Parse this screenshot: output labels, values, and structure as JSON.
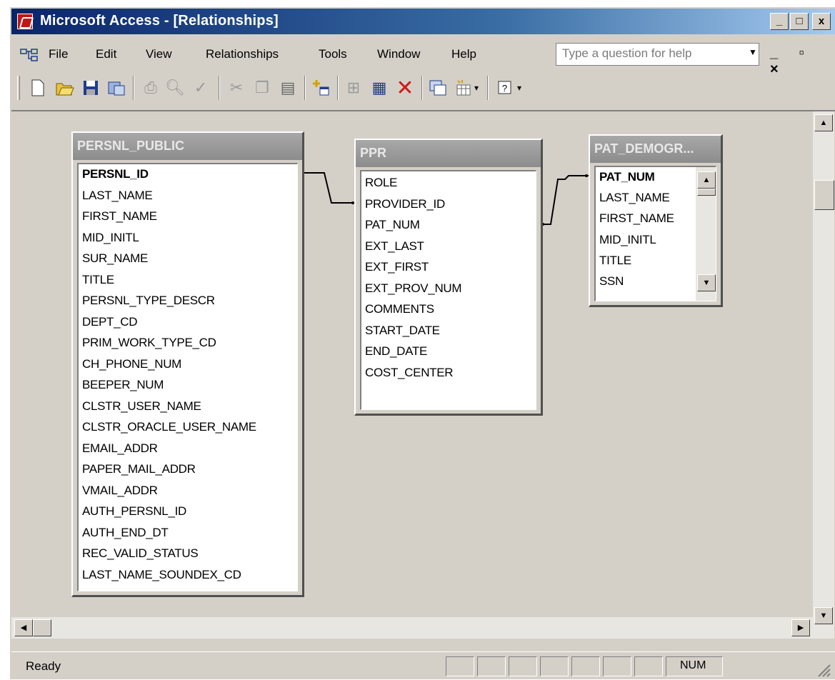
{
  "window": {
    "title": "Microsoft Access - [Relationships]",
    "caption_min": "_",
    "caption_max": "□",
    "caption_close": "x"
  },
  "menu": {
    "items": [
      "File",
      "Edit",
      "View",
      "Relationships",
      "Tools",
      "Window",
      "Help"
    ],
    "help_placeholder": "Type a question for help"
  },
  "toolbar": {
    "icons": [
      "new-icon",
      "open-icon",
      "save-icon",
      "database-window-icon",
      "print-icon",
      "print-preview-icon",
      "spelling-icon",
      "cut-icon",
      "copy-icon",
      "paste-icon",
      "show-table-icon",
      "show-direct-icon",
      "show-all-icon",
      "delete-icon",
      "new-object-icon",
      "new-object-dropdown-icon",
      "help-icon"
    ]
  },
  "tables": {
    "persnl_public": {
      "name": "PERSNL_PUBLIC",
      "key_field": "PERSNL_ID",
      "fields": [
        "LAST_NAME",
        "FIRST_NAME",
        "MID_INITL",
        "SUR_NAME",
        "TITLE",
        "PERSNL_TYPE_DESCR",
        "DEPT_CD",
        "PRIM_WORK_TYPE_CD",
        "CH_PHONE_NUM",
        "BEEPER_NUM",
        "CLSTR_USER_NAME",
        "CLSTR_ORACLE_USER_NAME",
        "EMAIL_ADDR",
        "PAPER_MAIL_ADDR",
        "VMAIL_ADDR",
        "AUTH_PERSNL_ID",
        "AUTH_END_DT",
        "REC_VALID_STATUS",
        "LAST_NAME_SOUNDEX_CD"
      ]
    },
    "ppr": {
      "name": "PPR",
      "fields": [
        "ROLE",
        "PROVIDER_ID",
        "PAT_NUM",
        "EXT_LAST",
        "EXT_FIRST",
        "EXT_PROV_NUM",
        "COMMENTS",
        "START_DATE",
        "END_DATE",
        "COST_CENTER"
      ]
    },
    "pat_demogr": {
      "name": "PAT_DEMOGR...",
      "key_field": "PAT_NUM",
      "fields": [
        "LAST_NAME",
        "FIRST_NAME",
        "MID_INITL",
        "TITLE",
        "SSN"
      ]
    }
  },
  "status": {
    "ready": "Ready",
    "num": "NUM"
  }
}
